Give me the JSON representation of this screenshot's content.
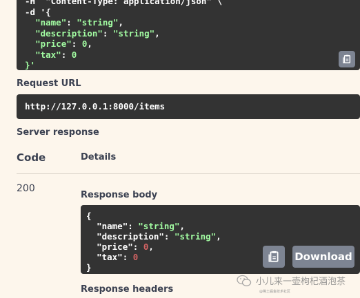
{
  "curl": {
    "line0": "-H  \"Content-Type: application/json\" \\",
    "line1": "-d '{",
    "line_name_key": "\"name\"",
    "line_name_val": "\"string\"",
    "line_desc_key": "\"description\"",
    "line_desc_val": "\"string\"",
    "line_price_key": "\"price\"",
    "line_price_val": "0",
    "line_tax_key": "\"tax\"",
    "line_tax_val": "0",
    "line_end": "}'"
  },
  "request_url": {
    "label": "Request URL",
    "value": "http://127.0.0.1:8000/items"
  },
  "server_response": {
    "label": "Server response",
    "code_header": "Code",
    "details_header": "Details",
    "code": "200",
    "body_label": "Response body",
    "body": {
      "open": "{",
      "name_key": "\"name\"",
      "name_val": "\"string\"",
      "desc_key": "\"description\"",
      "desc_val": "\"string\"",
      "price_key": "\"price\"",
      "price_val": "0",
      "tax_key": "\"tax\"",
      "tax_val": "0",
      "close": "}"
    },
    "download_label": "Download",
    "headers_label": "Response headers"
  },
  "watermark": {
    "text": "小儿来一壶枸杞酒泡茶",
    "sub": "@稀土掘金技术社区"
  },
  "icons": {
    "copy": "copy-icon",
    "wechat": "wechat-icon"
  }
}
